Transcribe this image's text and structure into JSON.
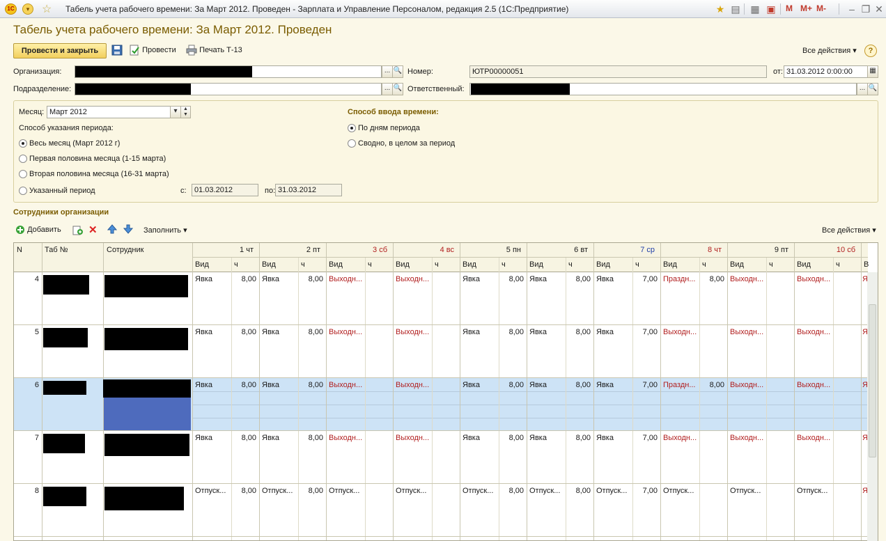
{
  "window": {
    "title": "Табель учета рабочего времени: За Март 2012. Проведен - Зарплата и Управление Персоналом, редакция 2.5  (1С:Предприятие)",
    "logo": "1С",
    "m_buttons": [
      "M",
      "M+",
      "M-"
    ]
  },
  "document": {
    "title": "Табель учета рабочего времени: За Март 2012. Проведен"
  },
  "toolbar": {
    "post_close": "Провести и закрыть",
    "post": "Провести",
    "print": "Печать Т-13",
    "all_actions": "Все действия",
    "help": "?"
  },
  "header": {
    "org_label": "Организация:",
    "dept_label": "Подразделение:",
    "number_label": "Номер:",
    "number_value": "ЮТР00000051",
    "date_label": "от:",
    "date_value": "31.03.2012  0:00:00",
    "resp_label": "Ответственный:",
    "choose_btn": "...",
    "search_btn": "🔍"
  },
  "period": {
    "month_label": "Месяц:",
    "month_value": "Март 2012",
    "mode_label": "Способ указания периода:",
    "options": [
      "Весь месяц (Март 2012 г)",
      "Первая половина месяца (1-15 марта)",
      "Вторая половина месяца (16-31 марта)",
      "Указанный период"
    ],
    "from_label": "с:",
    "from_value": "01.03.2012",
    "to_label": "по:",
    "to_value": "31.03.2012",
    "input_mode_title": "Способ ввода времени:",
    "input_options": [
      "По дням периода",
      "Сводно, в целом за период"
    ]
  },
  "employees": {
    "section_title": "Сотрудники организации",
    "add": "Добавить",
    "fill": "Заполнить",
    "all_actions": "Все действия",
    "columns": {
      "n": "N",
      "tab": "Таб №",
      "employee": "Сотрудник",
      "vid": "Вид",
      "h": "ч"
    },
    "days": [
      {
        "label": "1 чт",
        "kind": "work"
      },
      {
        "label": "2 пт",
        "kind": "work"
      },
      {
        "label": "3 сб",
        "kind": "weekend"
      },
      {
        "label": "4 вс",
        "kind": "weekend"
      },
      {
        "label": "5 пн",
        "kind": "work"
      },
      {
        "label": "6 вт",
        "kind": "work"
      },
      {
        "label": "7 ср",
        "kind": "short"
      },
      {
        "label": "8 чт",
        "kind": "holiday"
      },
      {
        "label": "9 пт",
        "kind": "work"
      },
      {
        "label": "10 сб",
        "kind": "weekend"
      }
    ],
    "rows": [
      {
        "n": "4",
        "cells": [
          [
            "Явка",
            "8,00"
          ],
          [
            "Явка",
            "8,00"
          ],
          [
            "Выходн...",
            ""
          ],
          [
            "Выходн...",
            ""
          ],
          [
            "Явка",
            "8,00"
          ],
          [
            "Явка",
            "8,00"
          ],
          [
            "Явка",
            "7,00"
          ],
          [
            "Праздн...",
            "8,00"
          ],
          [
            "Выходн...",
            ""
          ],
          [
            "Выходн...",
            ""
          ]
        ],
        "selected": false
      },
      {
        "n": "5",
        "cells": [
          [
            "Явка",
            "8,00"
          ],
          [
            "Явка",
            "8,00"
          ],
          [
            "Выходн...",
            ""
          ],
          [
            "Выходн...",
            ""
          ],
          [
            "Явка",
            "8,00"
          ],
          [
            "Явка",
            "8,00"
          ],
          [
            "Явка",
            "7,00"
          ],
          [
            "Выходн...",
            ""
          ],
          [
            "Выходн...",
            ""
          ],
          [
            "Выходн...",
            ""
          ]
        ],
        "selected": false
      },
      {
        "n": "6",
        "cells": [
          [
            "Явка",
            "8,00"
          ],
          [
            "Явка",
            "8,00"
          ],
          [
            "Выходн...",
            ""
          ],
          [
            "Выходн...",
            ""
          ],
          [
            "Явка",
            "8,00"
          ],
          [
            "Явка",
            "8,00"
          ],
          [
            "Явка",
            "7,00"
          ],
          [
            "Праздн...",
            "8,00"
          ],
          [
            "Выходн...",
            ""
          ],
          [
            "Выходн...",
            ""
          ]
        ],
        "selected": true
      },
      {
        "n": "7",
        "cells": [
          [
            "Явка",
            "8,00"
          ],
          [
            "Явка",
            "8,00"
          ],
          [
            "Выходн...",
            ""
          ],
          [
            "Выходн...",
            ""
          ],
          [
            "Явка",
            "8,00"
          ],
          [
            "Явка",
            "8,00"
          ],
          [
            "Явка",
            "7,00"
          ],
          [
            "Выходн...",
            ""
          ],
          [
            "Выходн...",
            ""
          ],
          [
            "Выходн...",
            ""
          ]
        ],
        "selected": false
      },
      {
        "n": "8",
        "cells": [
          [
            "Отпуск...",
            "8,00"
          ],
          [
            "Отпуск...",
            "8,00"
          ],
          [
            "Отпуск...",
            ""
          ],
          [
            "Отпуск...",
            ""
          ],
          [
            "Отпуск...",
            "8,00"
          ],
          [
            "Отпуск...",
            "8,00"
          ],
          [
            "Отпуск...",
            "7,00"
          ],
          [
            "Отпуск...",
            ""
          ],
          [
            "Отпуск...",
            ""
          ],
          [
            "Отпуск...",
            ""
          ]
        ],
        "selected": false
      }
    ],
    "next_col_hint": "В",
    "next_col_char": "Я"
  },
  "colors": {
    "accent": "#7a5c00",
    "weekend": "#b11e1e",
    "short_day": "#1f3ea8",
    "selected_row": "#cde3f6",
    "selected_cell": "#4e6bbd"
  }
}
